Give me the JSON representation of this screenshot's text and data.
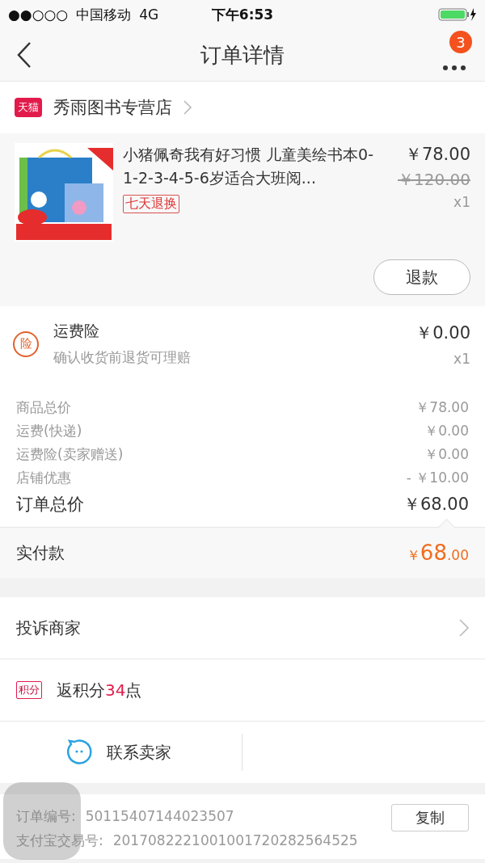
{
  "status_bar": {
    "signal_text": "●●○○○",
    "carrier": "中国移动",
    "network": "4G",
    "time": "下午6:53"
  },
  "nav": {
    "title": "订单详情",
    "badge": "3"
  },
  "shop": {
    "tag": "天猫",
    "name": "秀雨图书专营店"
  },
  "item": {
    "title": "小猪佩奇我有好习惯 儿童美绘书本0-1-2-3-4-5-6岁适合大班阅...",
    "tag": "七天退换",
    "price": "￥78.00",
    "original_price": "￥120.00",
    "quantity": "x1",
    "button": "退款"
  },
  "insurance": {
    "icon_text": "险",
    "title": "运费险",
    "subtitle": "确认收货前退货可理赔",
    "price": "￥0.00",
    "quantity": "x1"
  },
  "summary": [
    {
      "kind": "line",
      "label": "商品总价",
      "value": "￥78.00"
    },
    {
      "kind": "line",
      "label": "运费(快递)",
      "value": "￥0.00"
    },
    {
      "kind": "line",
      "label": "运费险(卖家赠送)",
      "value": "￥0.00"
    },
    {
      "kind": "line",
      "label": "店铺优惠",
      "value": "- ￥10.00"
    },
    {
      "kind": "total",
      "label": "订单总价",
      "value": "￥68.00"
    }
  ],
  "paid": {
    "label": "实付款",
    "currency": "￥",
    "amount": "68",
    "decimals": ".00"
  },
  "complaint": {
    "label": "投诉商家"
  },
  "points": {
    "tag": "积分",
    "prefix": "返积分",
    "value": "34",
    "suffix": "点"
  },
  "contact": {
    "label": "联系卖家"
  },
  "order_info": {
    "rows": [
      {
        "label": "订单编号:",
        "value": "50115407144023507"
      },
      {
        "label": "支付宝交易号:",
        "value": "2017082221001001720282564525"
      }
    ],
    "copy_button": "复制"
  }
}
